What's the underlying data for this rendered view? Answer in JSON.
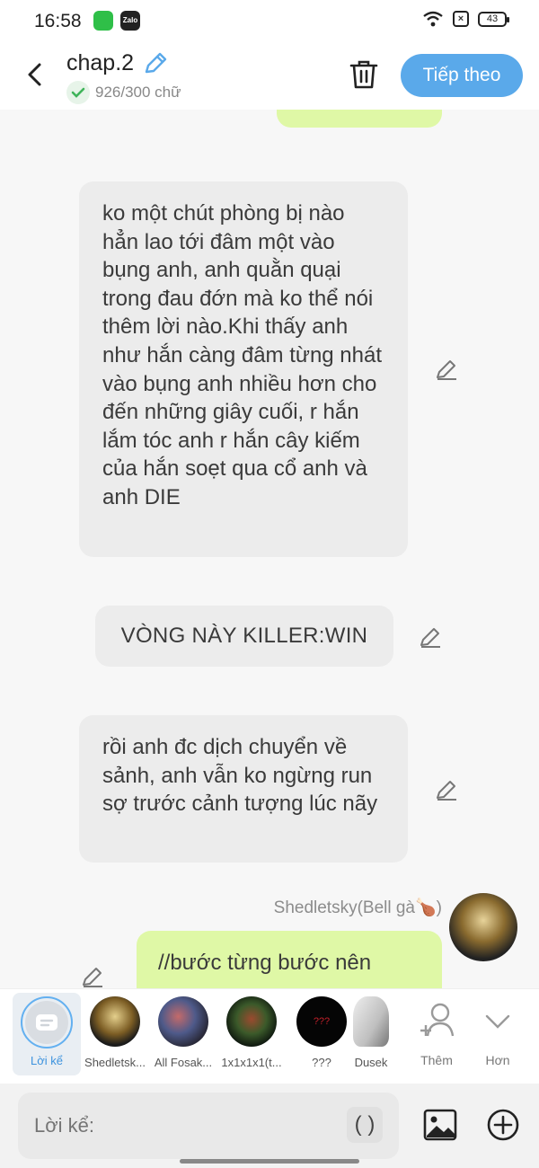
{
  "status_bar": {
    "time": "16:58",
    "battery": "43",
    "zalo_label": "Zalo"
  },
  "header": {
    "title": "chap.2",
    "word_count": "926/300 chữ",
    "next_label": "Tiếp theo"
  },
  "messages": {
    "top_partial": "...",
    "m1": "ko một chút phòng bị nào hẳn lao tới đâm một vào bụng anh, anh quằn quại trong đau đớn mà ko thể nói thêm lời nào.Khi thấy anh như hắn càng đâm từng nhát vào bụng anh nhiều hơn cho đến những giây cuối, r hắn lắm tóc anh r hắn cây kiếm của hắn soẹt qua cổ anh và anh DIE",
    "m2": "VÒNG NÀY KILLER:WIN",
    "m3": "rồi anh đc dịch chuyển về sảnh, anh vẫn ko ngừng run sợ trước cảnh tượng lúc nãy",
    "sender": "Shedletsky(Bell gà🍗)",
    "m4": "//bước từng bước nên"
  },
  "character_bar": {
    "narration_label": "Lời kể",
    "items": [
      {
        "label": "Shedletsk..."
      },
      {
        "label": "All Fosak..."
      },
      {
        "label": "1x1x1x1(t..."
      },
      {
        "label": "???"
      },
      {
        "label": "Dusek"
      }
    ],
    "add_label": "Thêm",
    "more_label": "Hơn",
    "unknown_avatar_text": "???"
  },
  "input": {
    "placeholder": "Lời kể:",
    "paren_label": "( )"
  },
  "colors": {
    "accent": "#5aa9ea",
    "user_bubble": "#dff8a6",
    "narration_bubble": "#ececec"
  }
}
